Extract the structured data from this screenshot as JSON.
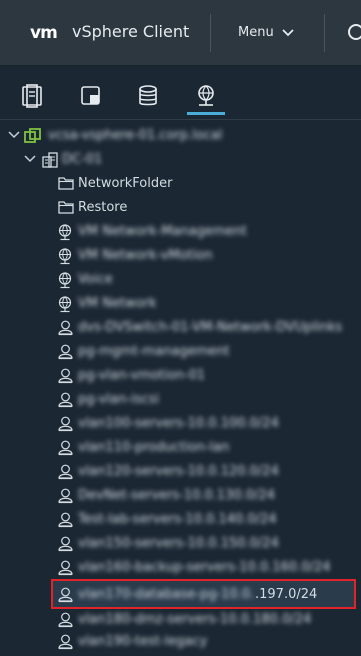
{
  "header": {
    "logo_text": "vm",
    "title": "vSphere Client",
    "menu_label": "Menu"
  },
  "tabs": [
    {
      "icon": "hosts-clusters-icon"
    },
    {
      "icon": "vms-templates-icon"
    },
    {
      "icon": "storage-icon"
    },
    {
      "icon": "networking-icon",
      "selected": true
    }
  ],
  "tree": {
    "vcenter": {
      "label": "vcsa-vsphere-01.corp.local"
    },
    "datacenter": {
      "label": "DC-01"
    },
    "folders": [
      {
        "label": "NetworkFolder"
      },
      {
        "label": "Restore"
      }
    ],
    "networks": [
      {
        "label": "VM Network-Management"
      },
      {
        "label": "VM Network-vMotion"
      },
      {
        "label": "Voice"
      },
      {
        "label": "VM Network"
      }
    ],
    "portgroups": [
      {
        "label": "dvs-DVSwitch-01-VM-Network-DVUplinks"
      },
      {
        "label": "pg-mgmt-management"
      },
      {
        "label": "pg-vlan-vmotion-01"
      },
      {
        "label": "pg-vlan-iscsi"
      },
      {
        "label": "vlan100-servers-10.0.100.0/24"
      },
      {
        "label": "vlan110-production-lan"
      },
      {
        "label": "vlan120-servers-10.0.120.0/24"
      },
      {
        "label": "DevNet-servers-10.0.130.0/24"
      },
      {
        "label": "Test-lab-servers-10.0.140.0/24"
      },
      {
        "label": "vlan150-servers-10.0.150.0/24"
      },
      {
        "label": "vlan160-backup-servers-10.0.160.0/24"
      },
      {
        "label": "vlan170-database-pg-10.0.",
        "suffix": ".197.0/24"
      },
      {
        "label": "vlan180-dmz-servers-10.0.180.0/24"
      },
      {
        "label": "vlan190-test-legacy"
      }
    ]
  }
}
